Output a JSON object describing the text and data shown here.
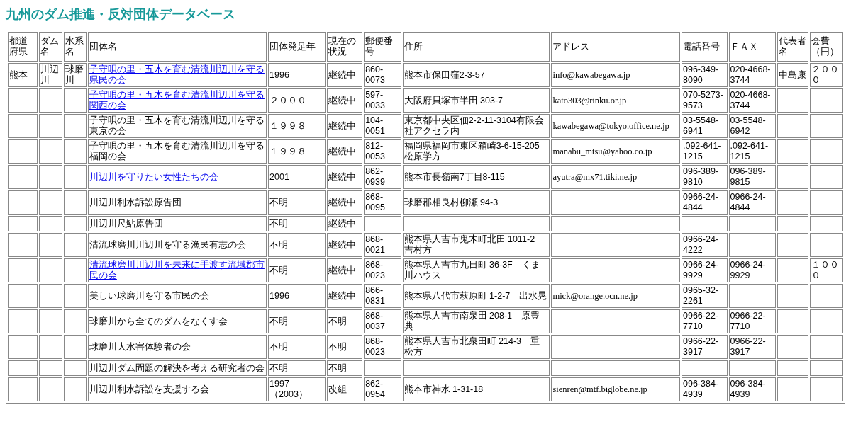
{
  "title": "九州のダム推進・反対団体データベース",
  "table": {
    "columns": [
      "都道府県",
      "ダム名",
      "水系名",
      "団体名",
      "団体発足年",
      "現在の状況",
      "郵便番号",
      "住所",
      "アドレス",
      "電話番号",
      "ＦＡＸ",
      "代表者名",
      "会費（円）"
    ],
    "rows": [
      {
        "prefecture": "熊本",
        "dam": "川辺川",
        "river": "球磨川",
        "name": "子守唄の里・五木を育む清流川辺川を守る県民の会",
        "name_is_link": true,
        "founded": "1996",
        "status": "継続中",
        "postal": "860-0073",
        "address": "熊本市保田窪2-3-57",
        "email": "info@kawabegawa.jp",
        "phone": "096-349-8090",
        "fax": "020-4668-3744",
        "representative": "中島康",
        "fee": "２０００"
      },
      {
        "name": "子守唄の里・五木を育む清流川辺川を守る関西の会",
        "name_is_link": true,
        "founded": "２０００",
        "status": "継続中",
        "postal": "597-0033",
        "address": "大阪府貝塚市半田 303-7",
        "email": "kato303@rinku.or.jp",
        "phone": "070-5273-9573",
        "fax": "020-4668-3744"
      },
      {
        "name": "子守唄の里・五木を育む清流川辺川を守る東京の会",
        "name_is_link": false,
        "founded": "１９９８",
        "status": "継続中",
        "postal": "104-0051",
        "address": "東京都中央区佃2-2-11-3104有限会社アクセラ内",
        "email": "kawabegawa@tokyo.office.ne.jp",
        "phone": "03-5548-6941",
        "fax": "03-5548-6942"
      },
      {
        "name": "子守唄の里・五木を育む清流川辺川を守る福岡の会",
        "name_is_link": false,
        "founded": "１９９８",
        "status": "継続中",
        "postal": "812-0053",
        "address": "福岡県福岡市東区箱崎3-6-15-205松原学方",
        "email": "manabu_mtsu@yahoo.co.jp",
        "phone": ".092-641-1215",
        "fax": ".092-641-1215"
      },
      {
        "name": "川辺川を守りたい女性たちの会",
        "name_is_link": true,
        "founded": "2001",
        "status": "継続中",
        "postal": "862-0939",
        "address": "熊本市長嶺南7丁目8-115",
        "email": "ayutra@mx71.tiki.ne.jp",
        "phone": "096-389-9810",
        "fax": "096-389-9815"
      },
      {
        "name": "川辺川利水訴訟原告団",
        "name_is_link": false,
        "founded": "不明",
        "status": "継続中",
        "postal": "868-0095",
        "address": "球磨郡相良村柳瀬 94-3",
        "phone": "0966-24-4844",
        "fax": "0966-24-4844"
      },
      {
        "name": "川辺川尺鮎原告団",
        "name_is_link": false,
        "founded": "不明",
        "status": "継続中"
      },
      {
        "name": "清流球磨川川辺川を守る漁民有志の会",
        "name_is_link": false,
        "founded": "不明",
        "status": "継続中",
        "postal": "868-0021",
        "address": "熊本県人吉市鬼木町北田 1011-2　吉村方",
        "phone": "0966-24-4222"
      },
      {
        "name": "清流球磨川川辺川を未来に手渡す流域郡市民の会",
        "name_is_link": true,
        "founded": "不明",
        "status": "継続中",
        "postal": "868-0023",
        "address": "熊本県人吉市九日町 36-3F　くま川ハウス",
        "phone": "0966-24-9929",
        "fax": "0966-24-9929",
        "fee": "１０００"
      },
      {
        "name": "美しい球磨川を守る市民の会",
        "name_is_link": false,
        "founded": "1996",
        "status": "継続中",
        "postal": "866-0831",
        "address": "熊本県八代市萩原町 1-2-7　出水晃",
        "email": "mick@orange.ocn.ne.jp",
        "phone": "0965-32-2261"
      },
      {
        "name": "球磨川から全てのダムをなくす会",
        "name_is_link": false,
        "founded": "不明",
        "status": "不明",
        "postal": "868-0037",
        "address": "熊本県人吉市南泉田 208-1　原豊典",
        "phone": "0966-22-7710",
        "fax": "0966-22-7710"
      },
      {
        "name": "球磨川大水害体験者の会",
        "name_is_link": false,
        "founded": "不明",
        "status": "不明",
        "postal": "868-0023",
        "address": "熊本県人吉市北泉田町 214-3　重松方",
        "phone": "0966-22-3917",
        "fax": "0966-22-3917"
      },
      {
        "name": "川辺川ダム問題の解決を考える研究者の会",
        "name_is_link": false,
        "founded": "不明",
        "status": "不明"
      },
      {
        "name": "川辺川利水訴訟を支援する会",
        "name_is_link": false,
        "founded": "1997（2003）",
        "status": "改組",
        "postal": "862-0954",
        "address": "熊本市神水 1-31-18",
        "email": "sienren@mtf.biglobe.ne.jp",
        "phone": "096-384-4939",
        "fax": "096-384-4939"
      }
    ]
  }
}
